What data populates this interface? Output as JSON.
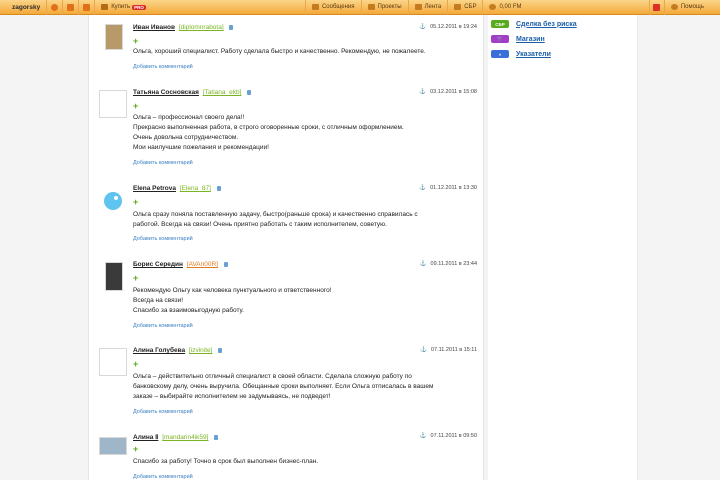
{
  "topbar": {
    "username": "zagorsky",
    "buy_label": "Купить",
    "buy_badge": "PRO",
    "messages_label": "Сообщения",
    "projects_label": "Проекты",
    "feed_label": "Лента",
    "sbr_label": "СБР",
    "balance_label": "0,00 FM",
    "help_label": "Помощь",
    "colors": {
      "bar": "#f4a93a",
      "badge": "#d92b2b"
    }
  },
  "sidebar": {
    "items": [
      {
        "badge": "СБР",
        "label": "Сделка без риска",
        "color": "#5aaa1e"
      },
      {
        "badge": "",
        "label": "Магазин",
        "icon": "cart-icon",
        "color": "#a33ec7"
      },
      {
        "badge": "",
        "label": "Указатели",
        "icon": "arrows-icon",
        "color": "#3a6fd9"
      }
    ]
  },
  "reviews": [
    {
      "name": "Иван Иванов",
      "login": "[diplomnrabota]",
      "date": "05.12.2011 в 19:24",
      "text": [
        "Ольга, хороший специалист. Работу сделала быстро и качественно. Рекомендую, не пожалеете."
      ],
      "add_comment": "Добавить комментарий"
    },
    {
      "name": "Татьяна Сосновская",
      "login": "[Tatiana_ekb]",
      "date": "03.12.2011 в 15:08",
      "text": [
        "Ольга – профессионал своего дела!!",
        "Прекрасно выполненная работа, в строго оговоренные сроки, с отличным оформлением.",
        "Очень довольна сотрудничеством.",
        "Мои наилучшие пожелания и рекомендации!"
      ],
      "add_comment": "Добавить комментарий"
    },
    {
      "name": "Elena Petrova",
      "login": "[Elena_87]",
      "date": "01.12.2011 в 13:30",
      "text": [
        "Ольга сразу поняла поставленную задачу, быстро(раньше срока) и качественно справилась с",
        "работой. Всегда на связи! Очень приятно работать с таким исполнителем, советую."
      ],
      "add_comment": "Добавить комментарий"
    },
    {
      "name": "Борис Середин",
      "login": "[AVAn00R]",
      "date": "09.11.2011 в 23:44",
      "text": [
        "Рекомендую Ольгу как человека пунктуального и ответственного!",
        "Всегда на связи!",
        "Спасибо за взаимовыгодную работу."
      ],
      "add_comment": "Добавить комментарий"
    },
    {
      "name": "Алина Голубева",
      "login": "[izvinite]",
      "date": "07.11.2011 в 15:11",
      "text": [
        "Ольга – действительно отличный специалист в своей области. Сделала сложную работу по",
        "банковскому делу, очень выручила. Обещанные сроки выполняет. Если Ольга отписалась в вашем",
        "заказе – выбирайте исполнителем не задумываясь, не подведет!"
      ],
      "add_comment": "Добавить комментарий"
    },
    {
      "name": "Алина Ⅱ",
      "login": "[mandarin4ik59]",
      "date": "07.11.2011 в 09:50",
      "text": [
        "Спасибо за работу! Точно в срок был выполнен бизнес-план."
      ],
      "add_comment": "Добавить комментарий"
    }
  ]
}
